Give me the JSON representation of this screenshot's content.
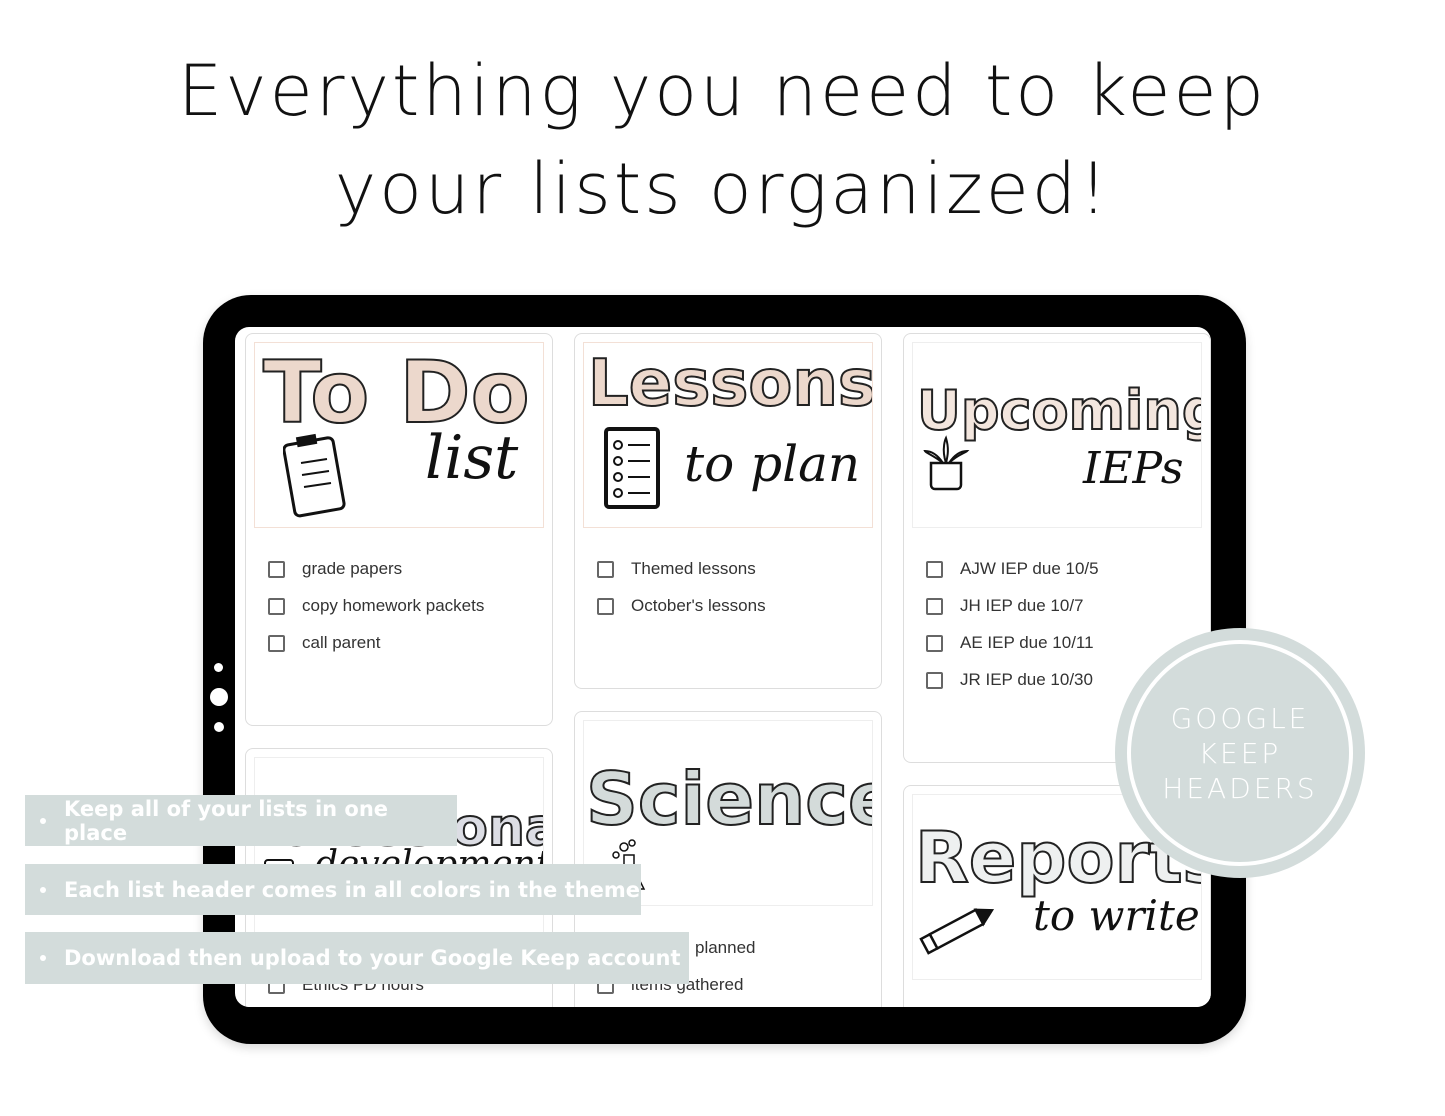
{
  "headline": {
    "line1": "Everything you need to keep",
    "line2": "your lists organized!"
  },
  "colors": {
    "banner": "#d3dcdb",
    "tablet": "#000000",
    "todo_header": "#ecd8cc",
    "science_header": "#d4dbda"
  },
  "cards": [
    {
      "title": "To Do",
      "subtitle": "list",
      "icon": "clipboard-icon",
      "items": [
        "grade papers",
        "copy homework packets",
        "call parent"
      ]
    },
    {
      "title": "Lessons",
      "subtitle": "to plan",
      "icon": "checklist-icon",
      "items": [
        "Themed lessons",
        "October's lessons"
      ]
    },
    {
      "title": "Upcoming",
      "subtitle": "IEPs",
      "icon": "plant-icon",
      "items": [
        "AJW IEP due 10/5",
        "JH IEP due 10/7",
        "AE IEP due 10/11",
        "JR IEP due 10/30"
      ]
    },
    {
      "title": "Professional",
      "subtitle": "development",
      "icon": "mug-icon",
      "items": [
        "Ethics PD hours"
      ]
    },
    {
      "title": "Science",
      "icon": "flask-icon",
      "items": [
        "planned",
        "items gathered"
      ]
    },
    {
      "title": "Reports",
      "subtitle": "to write",
      "icon": "pencil-icon",
      "items": []
    }
  ],
  "banners": [
    "Keep all of your lists in one place",
    "Each list header comes in all colors in the theme",
    "Download then upload to your Google Keep account"
  ],
  "badge": {
    "line1": "GOOGLE",
    "line2": "KEEP",
    "line3": "HEADERS"
  }
}
